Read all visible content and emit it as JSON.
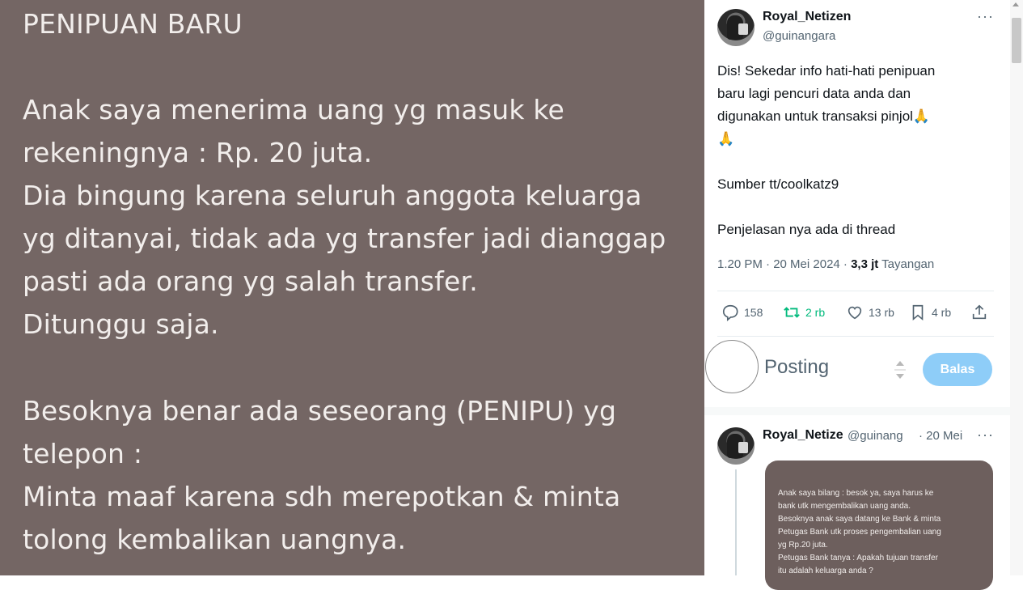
{
  "media": {
    "lines": [
      "PENIPUAN BARU",
      "",
      "Anak saya menerima uang yg masuk ke",
      "rekeningnya : Rp. 20 juta.",
      "Dia bingung karena seluruh anggota keluarga",
      "yg ditanyai, tidak ada yg transfer jadi dianggap",
      "pasti ada orang yg salah transfer.",
      "Ditunggu saja.",
      "",
      "Besoknya benar ada seseorang (PENIPU) yg",
      "telepon :",
      "Minta maaf karena sdh merepotkan & minta",
      "tolong kembalikan uangnya."
    ]
  },
  "tweet": {
    "author_name": "Royal_Netizen",
    "author_handle": "@guinangara",
    "more": "···",
    "text_lines": [
      "Dis!  Sekedar info hati-hati penipuan",
      "baru lagi pencuri data anda dan",
      "digunakan untuk transaksi pinjol🙏",
      "🙏",
      "",
      "Sumber tt/coolkatz9",
      "",
      "Penjelasan nya ada di thread"
    ],
    "timestamp": "1.20 PM · 20 Mei 2024 · ",
    "views_count": "3,3 jt",
    "views_label": " Tayangan",
    "actions": {
      "replies": "158",
      "retweets": "2 rb",
      "likes": "13 rb",
      "bookmarks": "4 rb"
    },
    "icons": [
      "reply-icon",
      "retweet-icon",
      "like-icon",
      "bookmark-icon",
      "share-icon"
    ],
    "accent_retweet": "#00ba7c"
  },
  "reply_box": {
    "placeholder": "Posting",
    "button_label": "Balas",
    "button_color": "#8ecdf8"
  },
  "thread_reply": {
    "author_name": "Royal_Netize",
    "author_handle": "@guinang",
    "date": "· 20 Mei",
    "more": "···",
    "media_lines": [
      "Anak saya bilang :  besok ya, saya harus ke",
      "bank utk mengembalikan uang anda.",
      "Besoknya anak saya datang ke Bank & minta",
      "Petugas Bank utk proses pengembalian uang",
      "yg Rp.20 juta.",
      "Petugas Bank tanya : Apakah tujuan transfer",
      "itu adalah keluarga anda ?"
    ]
  }
}
